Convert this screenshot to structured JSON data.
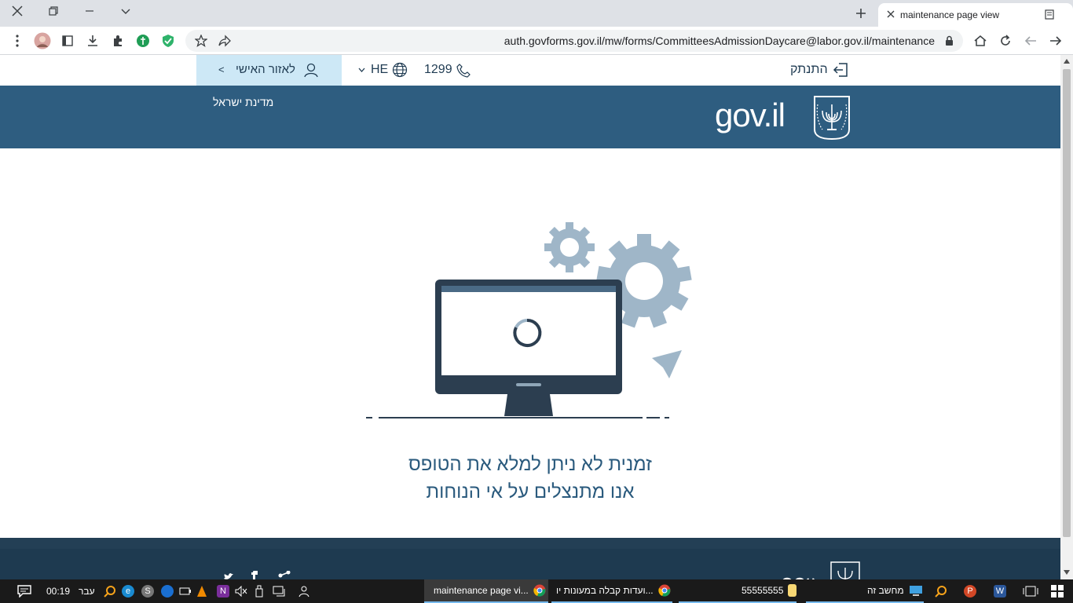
{
  "browser": {
    "tab_title": "maintenance page view",
    "url": "auth.govforms.gov.il/mw/forms/CommitteesAdmissionDaycare@labor.gov.il/maintenance"
  },
  "header": {
    "logout_label": "התנתק",
    "phone": "1299",
    "language": "HE",
    "personal_area_label": "לאזור האישי",
    "personal_chevron": "<",
    "logo_text": "gov.il",
    "state_label": "מדינת ישראל"
  },
  "main": {
    "line1": "זמנית לא ניתן למלא את הטופס",
    "line2": "אנו מתנצלים על אי הנוחות"
  },
  "taskbar": {
    "time": "00:19",
    "lang": "עבר",
    "task1": "maintenance page vi...",
    "task2": "ועדות קבלה במעונות יו...",
    "task3": "55555555",
    "task4": "מחשב זה",
    "word_label": "W",
    "ppt_label": "P",
    "onenote_label": "N",
    "skype_label": "S",
    "edge_label": "e"
  },
  "colors": {
    "masthead": "#2e5d80",
    "personal_bg": "#cde8f6",
    "message_text": "#2a5a7d",
    "gear": "#9fb6c8"
  }
}
